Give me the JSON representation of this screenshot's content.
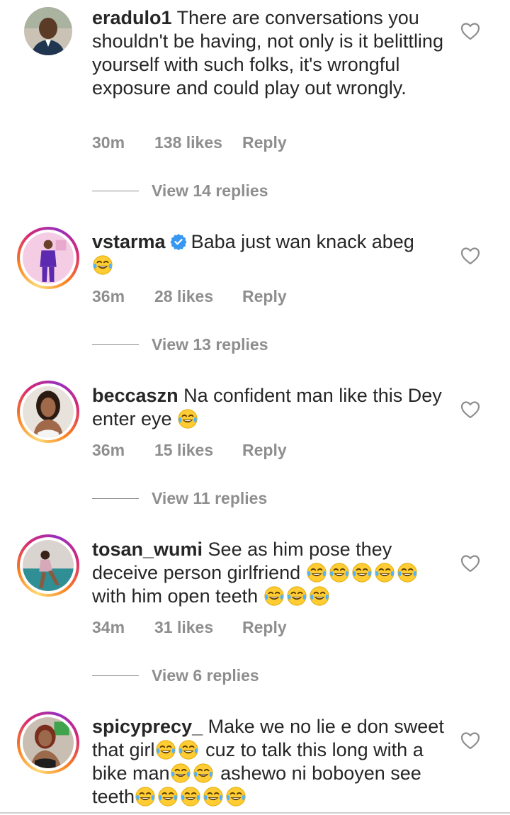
{
  "colors": {
    "text_primary": "#262626",
    "text_secondary": "#8e8e8e",
    "verified_blue": "#3897f0",
    "story_ring": [
      "#feda75",
      "#fa7e1e",
      "#d62976",
      "#962fbf"
    ]
  },
  "comments": [
    {
      "username": "eradulo1",
      "text": "There are conversations you shouldn't be having, not only is it belittling yourself with such folks, it's wrongful exposure and could play out wrongly.",
      "time": "30m",
      "likes": "138 likes",
      "reply_label": "Reply",
      "view_replies": "View 14 replies",
      "verified": false,
      "story_ring": false,
      "avatar_icon": "avatar-man-icon"
    },
    {
      "username": "vstarma",
      "text": "Baba just wan knack abeg",
      "emoji_count": 1,
      "time": "36m",
      "likes": "28 likes",
      "reply_label": "Reply",
      "view_replies": "View 13 replies",
      "verified": true,
      "story_ring": true,
      "avatar_icon": "avatar-purple-suit-icon"
    },
    {
      "username": "beccaszn",
      "text": "Na confident man like this Dey enter eye",
      "emoji_count": 1,
      "time": "36m",
      "likes": "15 likes",
      "reply_label": "Reply",
      "view_replies": "View 11 replies",
      "verified": false,
      "story_ring": true,
      "avatar_icon": "avatar-woman-icon"
    },
    {
      "username": "tosan_wumi",
      "text_line1": "See as him pose they deceive person girlfriend",
      "emoji_count_1": 5,
      "text_line2": "with him open teeth",
      "emoji_count_2": 3,
      "time": "34m",
      "likes": "31 likes",
      "reply_label": "Reply",
      "view_replies": "View 6 replies",
      "verified": false,
      "story_ring": true,
      "avatar_icon": "avatar-woman-seated-icon"
    },
    {
      "username": "spicyprecy_",
      "text_part1": "Make we no lie e don sweet that girl",
      "emoji_count_1": 2,
      "text_part2": "cuz to talk this long with a bike man",
      "emoji_count_2": 2,
      "text_part3": "ashewo ni boboyen see teeth",
      "emoji_count_3": 5,
      "verified": false,
      "story_ring": true,
      "avatar_icon": "avatar-woman-selfie-icon"
    }
  ],
  "icons": {
    "like": "heart-outline-icon",
    "verified": "verified-badge-icon",
    "emoji": "face-with-tears-of-joy-emoji"
  }
}
